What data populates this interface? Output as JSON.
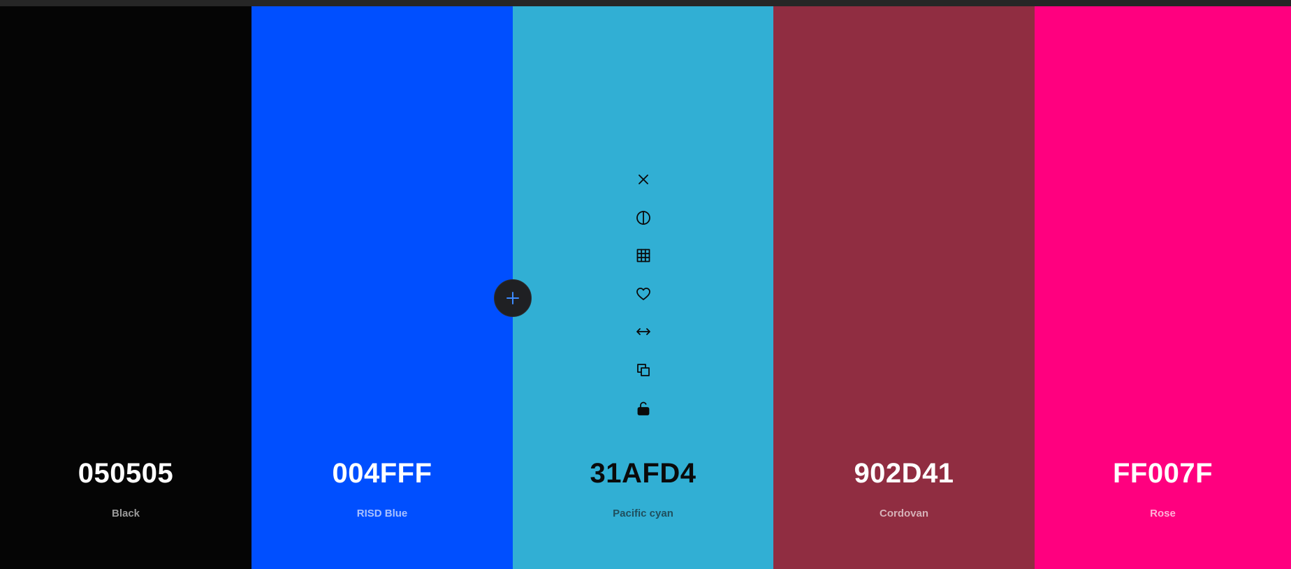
{
  "palette": {
    "colors": [
      {
        "hex": "050505",
        "name": "Black",
        "bg": "#050505",
        "hex_color": "#ffffff",
        "name_color": "#9a9a9a"
      },
      {
        "hex": "004FFF",
        "name": "RISD Blue",
        "bg": "#004fff",
        "hex_color": "#ffffff",
        "name_color": "#a8c1ff"
      },
      {
        "hex": "31AFD4",
        "name": "Pacific cyan",
        "bg": "#31afd4",
        "hex_color": "#0a0a0a",
        "name_color": "#1f4f5e"
      },
      {
        "hex": "902D41",
        "name": "Cordovan",
        "bg": "#902d41",
        "hex_color": "#ffffff",
        "name_color": "#d6b1b8"
      },
      {
        "hex": "FF007F",
        "name": "Rose",
        "bg": "#ff007f",
        "hex_color": "#ffffff",
        "name_color": "#ffb3d8"
      }
    ]
  },
  "toolbar": {
    "icons": [
      "close-icon",
      "contrast-icon",
      "grid-icon",
      "heart-icon",
      "drag-horizontal-icon",
      "copy-icon",
      "unlock-icon"
    ]
  },
  "add_button": {
    "icon": "plus-icon",
    "color": "#3d8bff"
  }
}
